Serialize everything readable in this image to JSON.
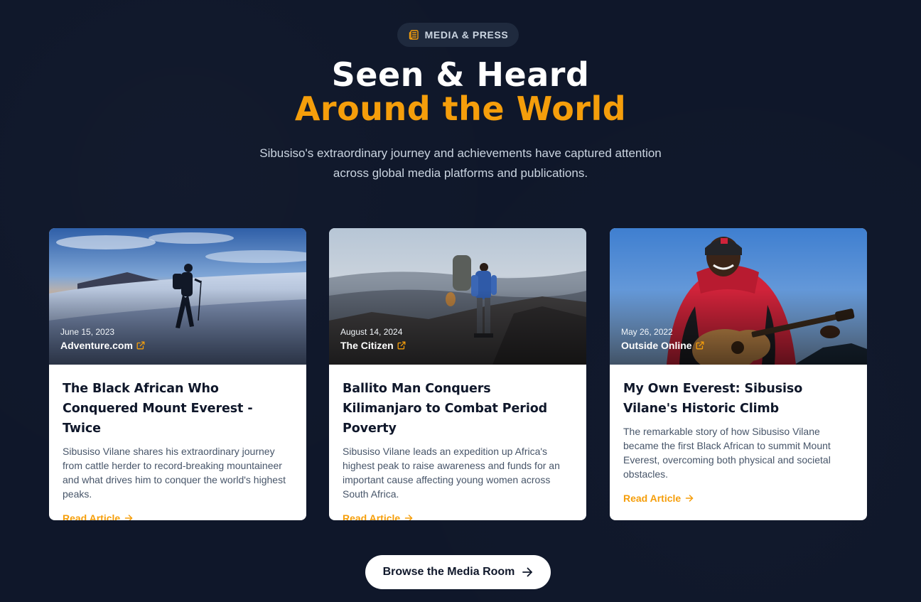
{
  "header": {
    "badge_label": "MEDIA & PRESS",
    "badge_icon": "newspaper-icon",
    "title_line1": "Seen & Heard",
    "title_line2": "Around the World",
    "subtitle_line1": "Sibusiso's extraordinary journey and achievements have captured attention",
    "subtitle_line2": "across global media platforms and publications."
  },
  "colors": {
    "background": "#0f172a",
    "accent": "#f59e0b",
    "card": "#ffffff",
    "title_text": "#0f172a",
    "body_text": "#475569"
  },
  "articles": [
    {
      "date": "June 15, 2023",
      "source": "Adventure.com",
      "title": "The Black African Who Conquered Mount Everest - Twice",
      "description": "Sibusiso Vilane shares his extraordinary journey from cattle herder to record-breaking mountaineer and what drives him to conquer the world's highest peaks.",
      "link_label": "Read Article"
    },
    {
      "date": "August 14, 2024",
      "source": "The Citizen",
      "title": "Ballito Man Conquers Kilimanjaro to Combat Period Poverty",
      "description": "Sibusiso Vilane leads an expedition up Africa's highest peak to raise awareness and funds for an important cause affecting young women across South Africa.",
      "link_label": "Read Article"
    },
    {
      "date": "May 26, 2022",
      "source": "Outside Online",
      "title": "My Own Everest: Sibusiso Vilane's Historic Climb",
      "description": "The remarkable story of how Sibusiso Vilane became the first Black African to summit Mount Everest, overcoming both physical and societal obstacles.",
      "link_label": "Read Article"
    }
  ],
  "cta": {
    "label": "Browse the Media Room",
    "icon": "arrow-right-icon"
  }
}
